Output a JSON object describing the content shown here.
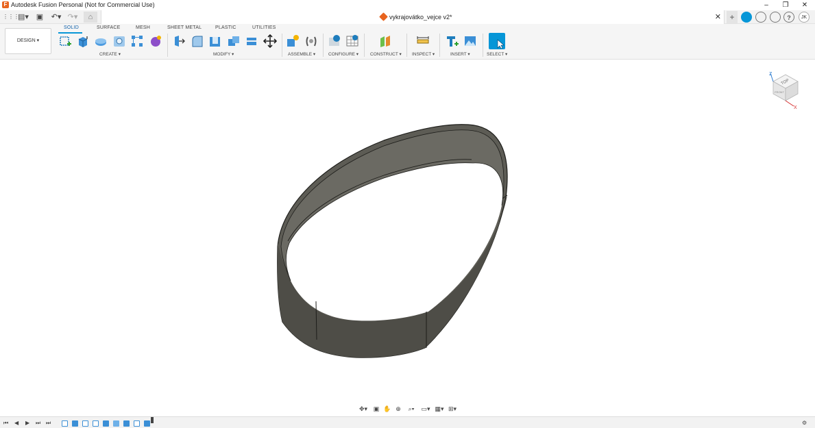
{
  "window": {
    "app_title": "Autodesk Fusion Personal (Not for Commercial Use)",
    "minimize": "–",
    "maximize": "❐",
    "close": "✕"
  },
  "quick_access": {
    "grid": "⋮⋮⋮",
    "file": "▤▾",
    "save": "▣",
    "undo": "↶▾",
    "redo": "↷▾",
    "home": "⌂"
  },
  "document": {
    "title": "vykrajovátko_vejce v2*",
    "close": "✕"
  },
  "account": {
    "initials": "JK",
    "new_tab": "+",
    "help": "?"
  },
  "workspace": {
    "label": "DESIGN ▾"
  },
  "tabs": [
    {
      "label": "SOLID",
      "active": true
    },
    {
      "label": "SURFACE"
    },
    {
      "label": "MESH"
    },
    {
      "label": "SHEET METAL"
    },
    {
      "label": "PLASTIC"
    },
    {
      "label": "UTILITIES"
    }
  ],
  "groups": {
    "create": "CREATE ▾",
    "modify": "MODIFY ▾",
    "assemble": "ASSEMBLE ▾",
    "configure": "CONFIGURE ▾",
    "construct": "CONSTRUCT ▾",
    "inspect": "INSPECT ▾",
    "insert": "INSERT ▾",
    "select": "SELECT ▾"
  },
  "viewcube": {
    "face": "TOP",
    "side": "FRONT",
    "axis_z": "Z",
    "axis_x": "X"
  },
  "colors": {
    "accent": "#0696d7",
    "model_wall": "#5d5c55",
    "model_wall_dark": "#4a4943",
    "model_edge": "#1d1d1a"
  }
}
